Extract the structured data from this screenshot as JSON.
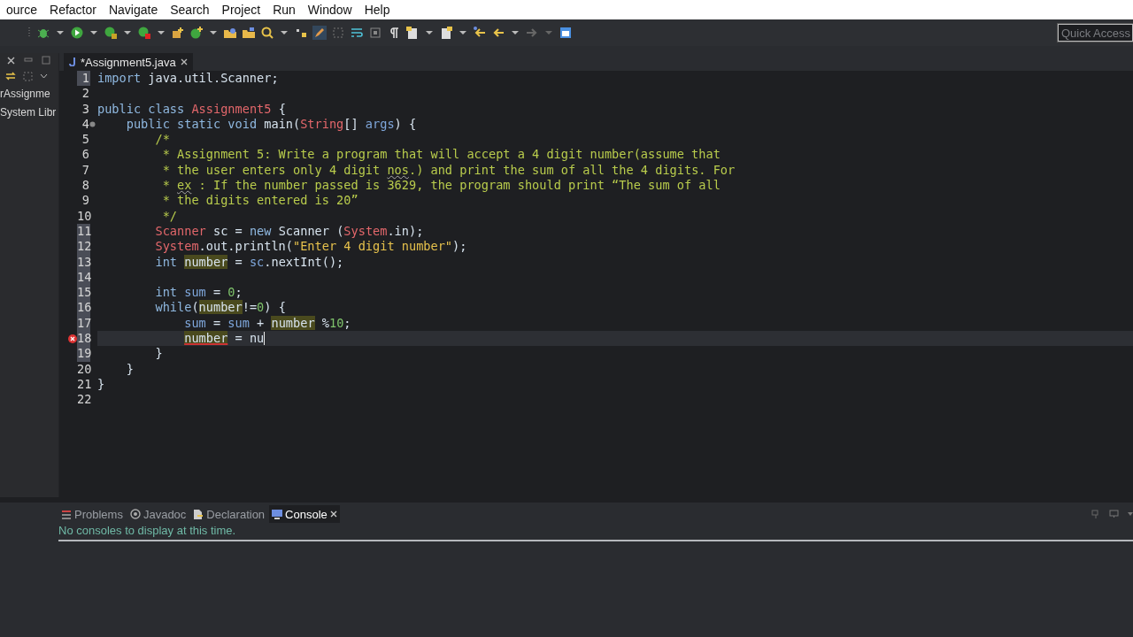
{
  "menu": [
    "ource",
    "Refactor",
    "Navigate",
    "Search",
    "Project",
    "Run",
    "Window",
    "Help"
  ],
  "quick_access": {
    "placeholder": "Quick Access"
  },
  "left_panel": {
    "items": [
      "rAssignme",
      "System Libr"
    ]
  },
  "editor": {
    "tab": {
      "label": "*Assignment5.java",
      "selected": true
    },
    "lines": [
      {
        "n": "1",
        "marked": true,
        "current": false,
        "error": false,
        "tokens": [
          {
            "t": "import",
            "color": "#8fb8e0"
          },
          {
            "t": " java.util.Scanner;"
          }
        ]
      },
      {
        "n": "2",
        "marked": false,
        "current": false,
        "error": false
      },
      {
        "n": "3",
        "marked": false,
        "current": false,
        "error": false,
        "tokens": [
          {
            "t": "public class ",
            "color": "#8fb8e0"
          },
          {
            "t": "Assignment5",
            "color": "#e3676b"
          },
          {
            "t": " {"
          }
        ]
      },
      {
        "n": "4",
        "marked": false,
        "current": false,
        "error": false,
        "fold": true,
        "tokens": [
          {
            "t": "    public static void",
            "color": "#8fb8e0"
          },
          {
            "t": " main("
          },
          {
            "t": "String",
            "color": "#e3676b"
          },
          {
            "t": "[] "
          },
          {
            "t": "args",
            "color": "#7fa7dc"
          },
          {
            "t": ") {"
          }
        ]
      },
      {
        "n": "5",
        "marked": false,
        "current": false,
        "error": false,
        "color": "#b9cc4c",
        "tokens": [
          {
            "t": "        /*"
          }
        ]
      },
      {
        "n": "6",
        "marked": false,
        "current": false,
        "error": false,
        "color": "#b9cc4c",
        "tokens": [
          {
            "t": "         * Assignment 5: Write a program that will accept a 4 digit number(assume that"
          }
        ]
      },
      {
        "n": "7",
        "marked": false,
        "current": false,
        "error": false,
        "color": "#b9cc4c",
        "tokens": [
          {
            "t": "         * the user enters only 4 digit "
          },
          {
            "t": "nos",
            "misspelled": true
          },
          {
            "t": ".) and print the sum of all the 4 digits. For"
          }
        ]
      },
      {
        "n": "8",
        "marked": false,
        "current": false,
        "error": false,
        "color": "#b9cc4c",
        "tokens": [
          {
            "t": "         * "
          },
          {
            "t": "ex",
            "misspelled": true
          },
          {
            "t": " : If the number passed is 3629, the program should print “The sum of all"
          }
        ]
      },
      {
        "n": "9",
        "marked": false,
        "current": false,
        "error": false,
        "color": "#b9cc4c",
        "tokens": [
          {
            "t": "         * the digits entered is 20”"
          }
        ]
      },
      {
        "n": "10",
        "marked": false,
        "current": false,
        "error": false,
        "color": "#b9cc4c",
        "tokens": [
          {
            "t": "         */"
          }
        ]
      },
      {
        "n": "11",
        "marked": true,
        "current": false,
        "error": false,
        "tokens": [
          {
            "t": "        Scanner",
            "color": "#e3676b"
          },
          {
            "t": " sc = "
          },
          {
            "t": "new",
            "color": "#8fb8e0"
          },
          {
            "t": " Scanner ("
          },
          {
            "t": "System",
            "color": "#e3676b"
          },
          {
            "t": ".in);"
          }
        ]
      },
      {
        "n": "12",
        "marked": true,
        "current": false,
        "error": false,
        "tokens": [
          {
            "t": "        System",
            "color": "#e3676b"
          },
          {
            "t": ".out.println("
          },
          {
            "t": "\"Enter 4 digit number\"",
            "color": "#e6c14c"
          },
          {
            "t": ");"
          }
        ]
      },
      {
        "n": "13",
        "marked": true,
        "current": false,
        "error": false,
        "tokens": [
          {
            "t": "        int ",
            "color": "#8fb8e0"
          },
          {
            "t": "number",
            "highlighted": true
          },
          {
            "t": " = "
          },
          {
            "t": "sc",
            "color": "#7fa7dc"
          },
          {
            "t": ".nextInt();"
          }
        ]
      },
      {
        "n": "14",
        "marked": true,
        "current": false,
        "error": false
      },
      {
        "n": "15",
        "marked": true,
        "current": false,
        "error": false,
        "tokens": [
          {
            "t": "        int ",
            "color": "#8fb8e0"
          },
          {
            "t": "sum",
            "color": "#7fa7dc"
          },
          {
            "t": " = "
          },
          {
            "t": "0",
            "color": "#7ec26b"
          },
          {
            "t": ";"
          }
        ]
      },
      {
        "n": "16",
        "marked": true,
        "current": false,
        "error": false,
        "tokens": [
          {
            "t": "        while",
            "color": "#8fb8e0"
          },
          {
            "t": "("
          },
          {
            "t": "number",
            "highlighted": true
          },
          {
            "t": "!="
          },
          {
            "t": "0",
            "color": "#7ec26b"
          },
          {
            "t": ") {"
          }
        ]
      },
      {
        "n": "17",
        "marked": true,
        "current": false,
        "error": false,
        "tokens": [
          {
            "t": "            sum",
            "color": "#7fa7dc"
          },
          {
            "t": " = "
          },
          {
            "t": "sum",
            "color": "#7fa7dc"
          },
          {
            "t": " + "
          },
          {
            "t": "number",
            "highlighted": true
          },
          {
            "t": " %"
          },
          {
            "t": "10",
            "color": "#7ec26b"
          },
          {
            "t": ";"
          }
        ]
      },
      {
        "n": "18",
        "marked": true,
        "current": true,
        "error": true,
        "tokens": [
          {
            "t": "            number",
            "highlighted": true
          },
          {
            "t": " = nu"
          }
        ]
      },
      {
        "n": "19",
        "marked": true,
        "current": false,
        "error": false,
        "tokens": [
          {
            "t": "        }"
          }
        ]
      },
      {
        "n": "20",
        "marked": false,
        "current": false,
        "error": false,
        "tokens": [
          {
            "t": "    }"
          }
        ]
      },
      {
        "n": "21",
        "marked": false,
        "current": false,
        "error": false,
        "tokens": [
          {
            "t": "}"
          }
        ]
      },
      {
        "n": "22",
        "marked": false,
        "current": false,
        "error": false
      }
    ]
  },
  "bottom_panel": {
    "tabs": [
      {
        "label": "Problems",
        "selected": false
      },
      {
        "label": "Javadoc",
        "selected": false
      },
      {
        "label": "Declaration",
        "selected": false
      },
      {
        "label": "Console",
        "selected": true
      }
    ],
    "message": "No consoles to display at this time."
  }
}
